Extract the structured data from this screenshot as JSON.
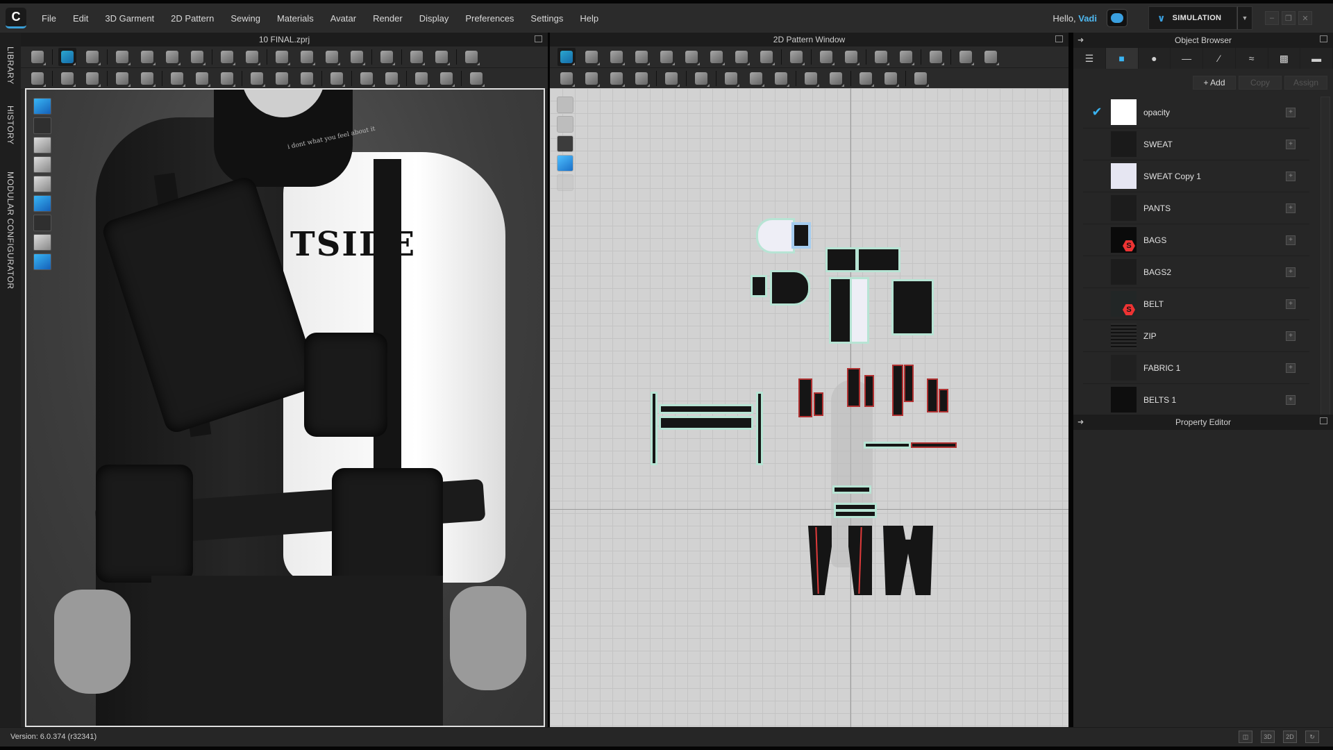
{
  "menubar": {
    "items": [
      "File",
      "Edit",
      "3D Garment",
      "2D Pattern",
      "Sewing",
      "Materials",
      "Avatar",
      "Render",
      "Display",
      "Preferences",
      "Settings",
      "Help"
    ],
    "greeting": "Hello,",
    "username": "Vadi",
    "mode_label": "SIMULATION",
    "window_controls": [
      "minimize",
      "restore",
      "close"
    ]
  },
  "side_tabs": [
    "LIBRARY",
    "HISTORY",
    "MODULAR CONFIGURATOR"
  ],
  "window3d": {
    "title": "10 FINAL.zprj",
    "chest_text": "TSIDE",
    "collar_text": "i dont what you feel about it"
  },
  "window2d": {
    "title": "2D Pattern Window"
  },
  "object_browser": {
    "title": "Object Browser",
    "tabs": [
      "list-icon",
      "fabric-icon",
      "button-icon",
      "buttonhole-icon",
      "topstitch-icon",
      "zipper-icon",
      "graphic-icon",
      "measure-icon"
    ],
    "add_label": "+ Add",
    "copy_label": "Copy",
    "assign_label": "Assign",
    "items": [
      {
        "name": "opacity",
        "checked": true,
        "swatch": "#ffffff"
      },
      {
        "name": "SWEAT",
        "checked": false,
        "swatch": "#1a1a1a"
      },
      {
        "name": "SWEAT Copy 1",
        "checked": false,
        "swatch": "#e6e6f2"
      },
      {
        "name": "PANTS",
        "checked": false,
        "swatch": "#1c1c1c"
      },
      {
        "name": "BAGS",
        "checked": false,
        "swatch": "#0a0a0a",
        "logo": "S"
      },
      {
        "name": "BAGS2",
        "checked": false,
        "swatch": "#1c1c1c"
      },
      {
        "name": "BELT",
        "checked": false,
        "swatch": "#222626",
        "logo": "S"
      },
      {
        "name": "ZIP",
        "checked": false,
        "swatch": "zip"
      },
      {
        "name": "FABRIC 1",
        "checked": false,
        "swatch": "#202020"
      },
      {
        "name": "BELTS 1",
        "checked": false,
        "swatch": "#0e0e0e"
      }
    ]
  },
  "property_editor": {
    "title": "Property Editor"
  },
  "statusbar": {
    "version": "Version: 6.0.374 (r32341)",
    "view_buttons": [
      "",
      "3D",
      "2D"
    ]
  },
  "colors": {
    "accent": "#3ab4f2",
    "panel_bg": "#262626",
    "pattern_bg": "#d2d2d2"
  }
}
